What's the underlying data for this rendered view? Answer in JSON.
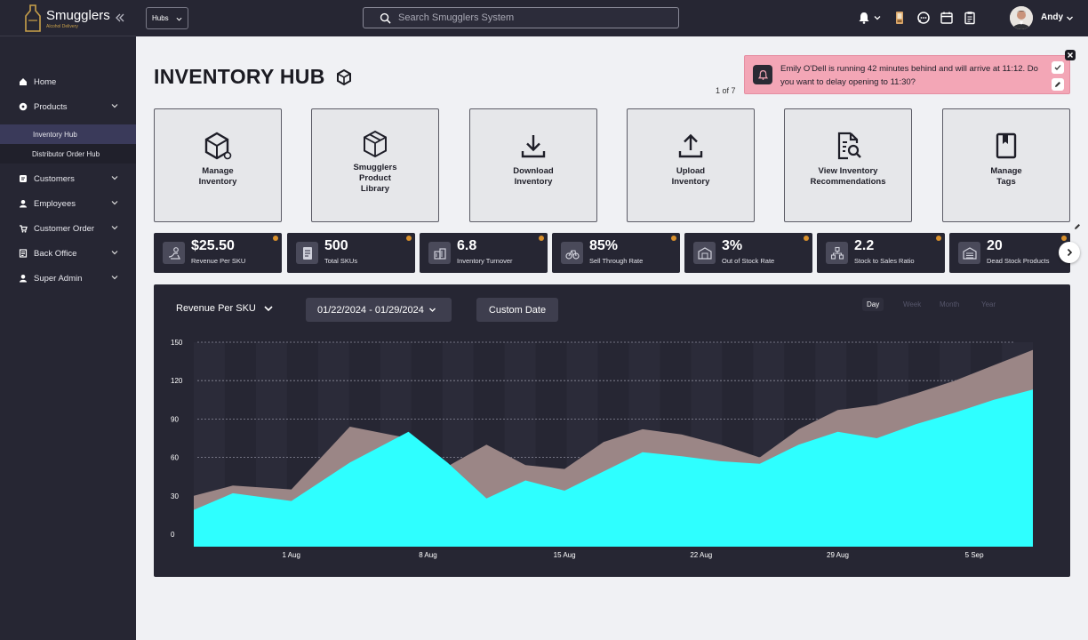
{
  "brand": {
    "name": "Smugglers",
    "tagline": "Alcohol Delivery"
  },
  "topbar": {
    "hubs_label": "Hubs",
    "search_placeholder": "Search Smugglers System",
    "user_name": "Andy"
  },
  "sidebar": {
    "items": [
      {
        "label": "Home",
        "icon": "home-icon"
      },
      {
        "label": "Products",
        "icon": "tag-icon"
      },
      {
        "label": "Customers",
        "icon": "customers-icon"
      },
      {
        "label": "Employees",
        "icon": "employees-icon"
      },
      {
        "label": "Customer Order",
        "icon": "order-icon"
      },
      {
        "label": "Back Office",
        "icon": "back-office-icon"
      },
      {
        "label": "Super Admin",
        "icon": "admin-icon"
      }
    ],
    "sub_items": [
      {
        "label": "Inventory Hub",
        "active": true
      },
      {
        "label": "Distributor Order Hub",
        "active": false
      }
    ]
  },
  "page": {
    "title": "INVENTORY HUB"
  },
  "notification": {
    "message": "Emily O'Dell is running 42 minutes behind and will arrive at 11:12. Do you want to delay opening to 11:30?",
    "pager": "1 of 7"
  },
  "actions": [
    {
      "label": "Manage\nInventory",
      "icon": "cube-settings-icon"
    },
    {
      "label": "Smugglers\nProduct\nLibrary",
      "icon": "package-icon"
    },
    {
      "label": "Download\nInventory",
      "icon": "download-icon"
    },
    {
      "label": "Upload\nInventory",
      "icon": "upload-icon"
    },
    {
      "label": "View Inventory\nRecommendations",
      "icon": "document-search-icon"
    },
    {
      "label": "Manage\nTags",
      "icon": "bookmark-icon"
    }
  ],
  "metrics": [
    {
      "value": "$25.50",
      "label": "Revenue Per SKU",
      "icon": "revenue-icon"
    },
    {
      "value": "500",
      "label": "Total SKUs",
      "icon": "document-icon"
    },
    {
      "value": "6.8",
      "label": "Inventory Turnover",
      "icon": "turnover-icon"
    },
    {
      "value": "85%",
      "label": "Sell Through Rate",
      "icon": "bicycle-icon"
    },
    {
      "value": "3%",
      "label": "Out of Stock Rate",
      "icon": "warehouse-icon"
    },
    {
      "value": "2.2",
      "label": "Stock to Sales Ratio",
      "icon": "boxes-icon"
    },
    {
      "value": "20",
      "label": "Dead Stock Products",
      "icon": "dead-stock-icon"
    }
  ],
  "chart_controls": {
    "metric": "Revenue Per SKU",
    "date_range": "01/22/2024 - 01/29/2024",
    "custom_date": "Custom Date",
    "periods": [
      "Day",
      "Week",
      "Month",
      "Year"
    ],
    "active_period": "Day"
  },
  "colors": {
    "sidebar_bg": "#262633",
    "accent_cyan": "#2effff",
    "series_upper": "#9b8686",
    "notification_bg": "#f3a6b6",
    "info_dot": "#d9902c"
  },
  "chart_data": {
    "type": "area",
    "title": "",
    "xlabel": "",
    "ylabel": "",
    "ylim": [
      0,
      150
    ],
    "yticks": [
      0,
      30,
      60,
      90,
      120,
      150
    ],
    "x_ticks": [
      "1 Aug",
      "8 Aug",
      "15 Aug",
      "22 Aug",
      "29 Aug",
      "5 Sep"
    ],
    "x": [
      -5,
      -3,
      0,
      3,
      6,
      8,
      10,
      12,
      14,
      16,
      18,
      20,
      22,
      24,
      26,
      28,
      30,
      32,
      34,
      36,
      38
    ],
    "series": [
      {
        "values": [
          19,
          32,
          26,
          56,
          80,
          56,
          28,
          42,
          34,
          49,
          64,
          61,
          57,
          55,
          70,
          80,
          75,
          86,
          95,
          105,
          113
        ]
      },
      {
        "values": [
          30,
          38,
          35,
          84,
          75,
          53,
          70,
          54,
          51,
          72,
          82,
          78,
          70,
          60,
          82,
          97,
          101,
          110,
          120,
          132,
          144
        ]
      }
    ]
  }
}
